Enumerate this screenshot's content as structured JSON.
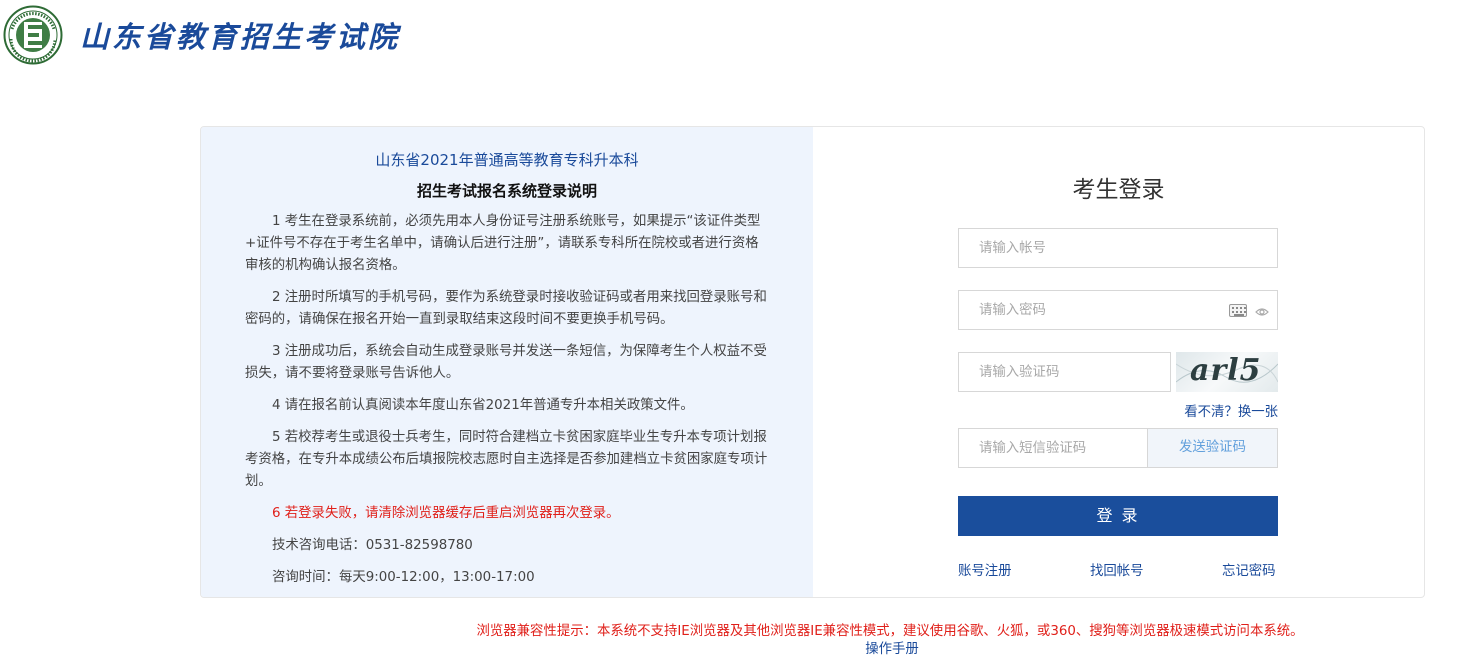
{
  "header": {
    "site_title": "山东省教育招生考试院",
    "logo_icon": "school-seal-logo-icon",
    "logo_color": "#2e6b35"
  },
  "notice": {
    "title": "山东省2021年普通高等教育专科升本科",
    "subtitle": "招生考试报名系统登录说明",
    "items": [
      "1 考生在登录系统前，必须先用本人身份证号注册系统账号，如果提示“该证件类型+证件号不存在于考生名单中，请确认后进行注册”，请联系专科所在院校或者进行资格审核的机构确认报名资格。",
      "2 注册时所填写的手机号码，要作为系统登录时接收验证码或者用来找回登录账号和密码的，请确保在报名开始一直到录取结束这段时间不要更换手机号码。",
      "3 注册成功后，系统会自动生成登录账号并发送一条短信，为保障考生个人权益不受损失，请不要将登录账号告诉他人。",
      "4 请在报名前认真阅读本年度山东省2021年普通专升本相关政策文件。",
      "5 若校荐考生或退役士兵考生，同时符合建档立卡贫困家庭毕业生专升本专项计划报考资格，在专升本成绩公布后填报院校志愿时自主选择是否参加建档立卡贫困家庭专项计划。"
    ],
    "warning": "6 若登录失败，请清除浏览器缓存后重启浏览器再次登录。",
    "phone": "技术咨询电话：0531-82598780",
    "hours": "咨询时间：每天9:00-12:00，13:00-17:00"
  },
  "login": {
    "title": "考生登录",
    "account_placeholder": "请输入帐号",
    "password_placeholder": "请输入密码",
    "captcha_placeholder": "请输入验证码",
    "captcha_text": "arl5",
    "refresh_label": "看不清？换一张",
    "sms_placeholder": "请输入短信验证码",
    "send_sms_label": "发送验证码",
    "submit_label": "登 录",
    "register_label": "账号注册",
    "recover_label": "找回帐号",
    "forgot_label": "忘记密码",
    "keyboard_icon": "keyboard-icon",
    "eye_icon": "eye-icon"
  },
  "footer": {
    "compat_notice": "浏览器兼容性提示：本系统不支持IE浏览器及其他浏览器IE兼容性模式，建议使用谷歌、火狐，或360、搜狗等浏览器极速模式访问本系统。",
    "manual_link": "操作手册"
  },
  "colors": {
    "brand_blue": "#1a4e9c",
    "warning_red": "#e0201a",
    "notice_bg": "#eef4fd"
  }
}
